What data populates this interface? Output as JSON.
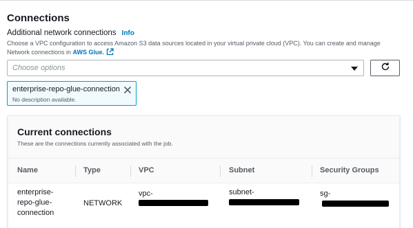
{
  "section": {
    "title": "Connections"
  },
  "field": {
    "label": "Additional network connections",
    "info_link": "Info",
    "description_text": "Choose a VPC configuration to access Amazon S3 data sources located in your virtual private cloud (VPC). You can create and manage Network connections in ",
    "description_link": "AWS Glue.",
    "placeholder": "Choose options",
    "refresh_icon": "refresh-icon",
    "external_link_icon": "external-link-icon"
  },
  "selected_token": {
    "label": "enterprise-repo-glue-connection",
    "description": "No description available.",
    "close_icon": "close-icon"
  },
  "current_connections": {
    "title": "Current connections",
    "subtitle": "These are the connections currently associated with the job.",
    "columns": [
      "Name",
      "Type",
      "VPC",
      "Subnet",
      "Security Groups"
    ],
    "rows": [
      {
        "name_lines": [
          "enterprise-",
          "repo-glue-",
          "connection"
        ],
        "type": "NETWORK",
        "vpc": "vpc-",
        "subnet": "subnet-",
        "security_groups": "sg-"
      }
    ]
  },
  "colors": {
    "link": "#0073bb",
    "token_border": "#00a1c9",
    "token_bg": "#f1faff",
    "redaction": "#000000"
  }
}
